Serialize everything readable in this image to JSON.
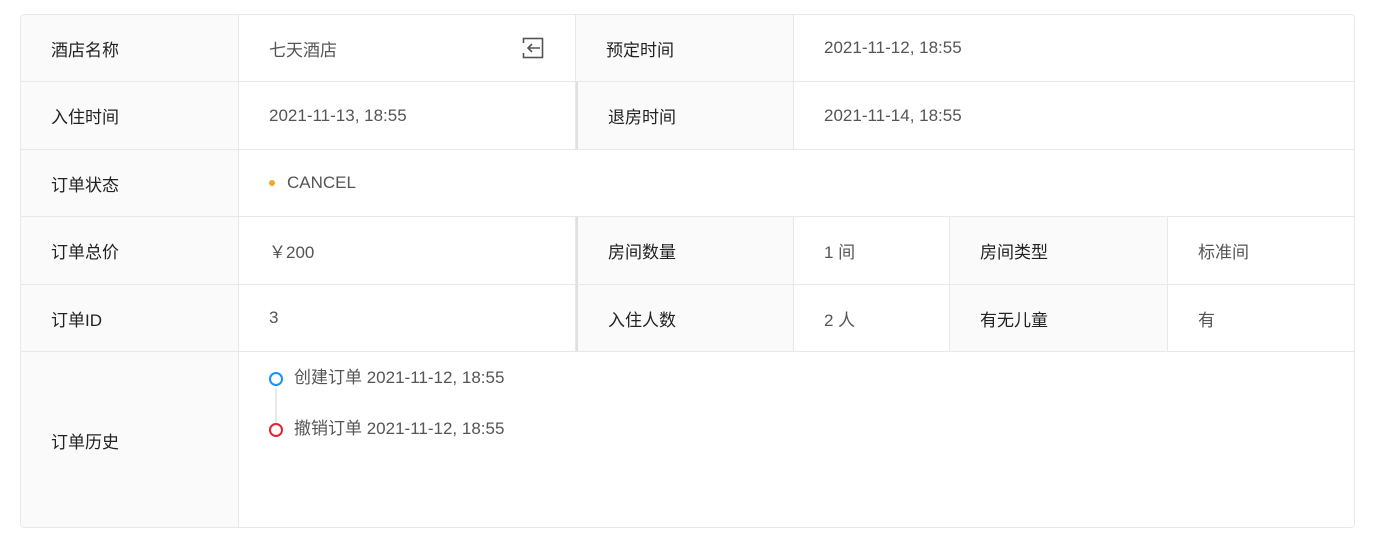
{
  "rows": {
    "hotel": {
      "label": "酒店名称",
      "value": "七天酒店",
      "booking_time_label": "预定时间",
      "booking_time": "2021-11-12, 18:55"
    },
    "checkin": {
      "label": "入住时间",
      "value": "2021-11-13, 18:55",
      "checkout_label": "退房时间",
      "checkout_value": "2021-11-14, 18:55"
    },
    "status": {
      "label": "订单状态",
      "value": "CANCEL",
      "dot_color": "#f5a623"
    },
    "price": {
      "label": "订单总价",
      "value": "￥200",
      "room_count_label": "房间数量",
      "room_count": "1 间",
      "room_type_label": "房间类型",
      "room_type": "标准间"
    },
    "order": {
      "label": "订单ID",
      "value": "3",
      "people_label": "入住人数",
      "people": "2 人",
      "children_label": "有无儿童",
      "children": "有"
    },
    "history": {
      "label": "订单历史",
      "events": [
        {
          "text": "创建订单 2021-11-12, 18:55",
          "color": "#1890ff"
        },
        {
          "text": "撤销订单 2021-11-12, 18:55",
          "color": "#e8222f"
        }
      ]
    }
  },
  "icons": {
    "copy": "copy-icon"
  }
}
